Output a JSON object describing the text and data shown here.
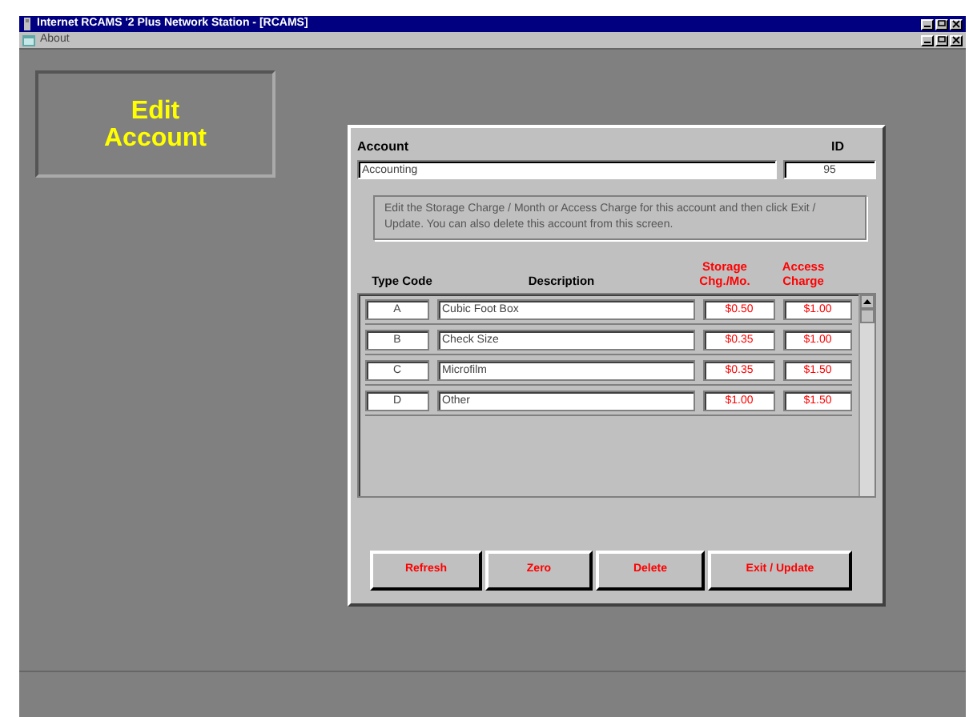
{
  "window": {
    "title": "Internet RCAMS '2 Plus Network Station - [RCAMS]"
  },
  "menu": [
    {
      "label": "About"
    }
  ],
  "heading": {
    "label": "Edit Account"
  },
  "dialog": {
    "account_label": "Account",
    "account_value": "Accounting",
    "id_label": "ID",
    "id_value": "95",
    "instructions": "Edit the Storage Charge / Month or Access Charge for this account and then click Exit / Update.  You can also delete this account from this screen.",
    "columns": [
      {
        "label": "Type Code",
        "kind": "plain"
      },
      {
        "label": "Description",
        "kind": "plain"
      },
      {
        "label": "Storage Chg./Mo.",
        "kind": "charge"
      },
      {
        "label": "Access Charge",
        "kind": "charge"
      }
    ],
    "rows": [
      {
        "code": "A",
        "description": "Cubic Foot Box",
        "storage": "$0.50",
        "access": "$1.00"
      },
      {
        "code": "B",
        "description": "Check Size",
        "storage": "$0.35",
        "access": "$1.00"
      },
      {
        "code": "C",
        "description": "Microfilm",
        "storage": "$0.35",
        "access": "$1.50"
      },
      {
        "code": "D",
        "description": "Other",
        "storage": "$1.00",
        "access": "$1.50"
      }
    ],
    "buttons": [
      {
        "label": "Refresh"
      },
      {
        "label": "Zero"
      },
      {
        "label": "Delete"
      },
      {
        "label": "Exit / Update"
      }
    ]
  }
}
